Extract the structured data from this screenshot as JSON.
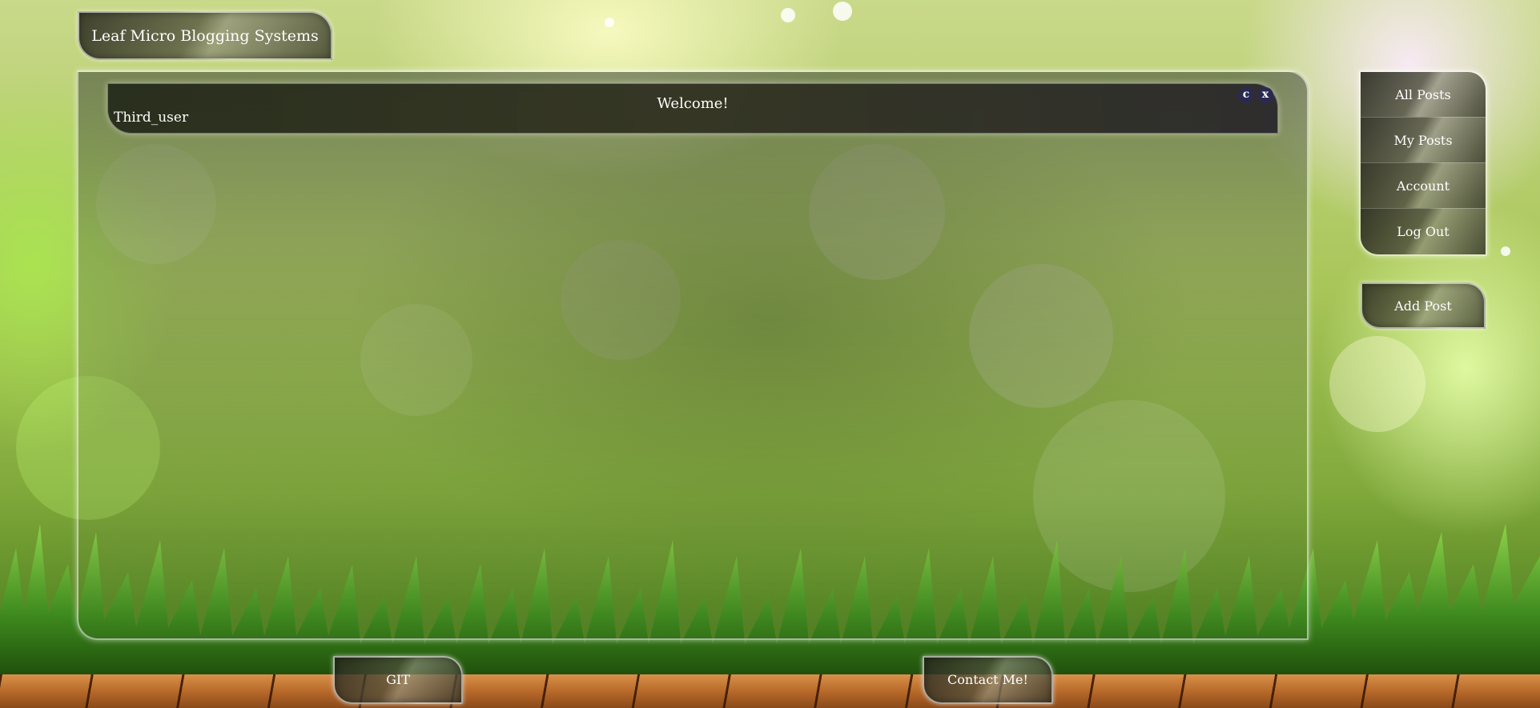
{
  "brand": {
    "title": "Leaf Micro Blogging Systems"
  },
  "header": {
    "welcome": "Welcome!",
    "username": "Third_user",
    "controls": {
      "c_label": "c",
      "x_label": "x"
    }
  },
  "nav": {
    "items": [
      {
        "label": "All Posts"
      },
      {
        "label": "My Posts"
      },
      {
        "label": "Account"
      },
      {
        "label": "Log Out"
      }
    ],
    "add_post_label": "Add Post"
  },
  "footer": {
    "git_label": "GIT",
    "contact_label": "Contact Me!"
  },
  "colors": {
    "text": "#ffffff",
    "glass_dark": "#2d2d22",
    "control_bg": "#2a2a50"
  }
}
